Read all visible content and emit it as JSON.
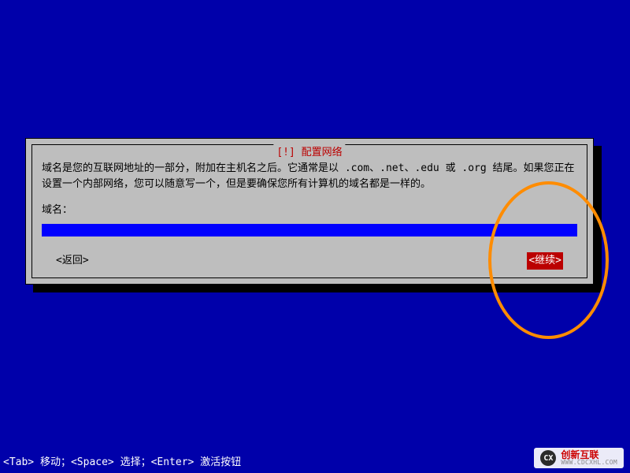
{
  "dialog": {
    "title": "[!] 配置网络",
    "description": "域名是您的互联网地址的一部分，附加在主机名之后。它通常是以 .com、.net、.edu 或 .org 结尾。如果您正在设置一个内部网络，您可以随意写一个，但是要确保您所有计算机的域名都是一样的。",
    "label": "域名：",
    "input_value": "",
    "back_label": "<返回>",
    "continue_label": "<继续>"
  },
  "footer_hint": "<Tab> 移动；<Space> 选择；<Enter> 激活按钮",
  "watermark": {
    "icon_text": "CX",
    "brand": "创新互联",
    "domain": "WWW.CDCXHL.COM"
  },
  "annotation": {
    "ellipse_color": "#FF8C00"
  }
}
